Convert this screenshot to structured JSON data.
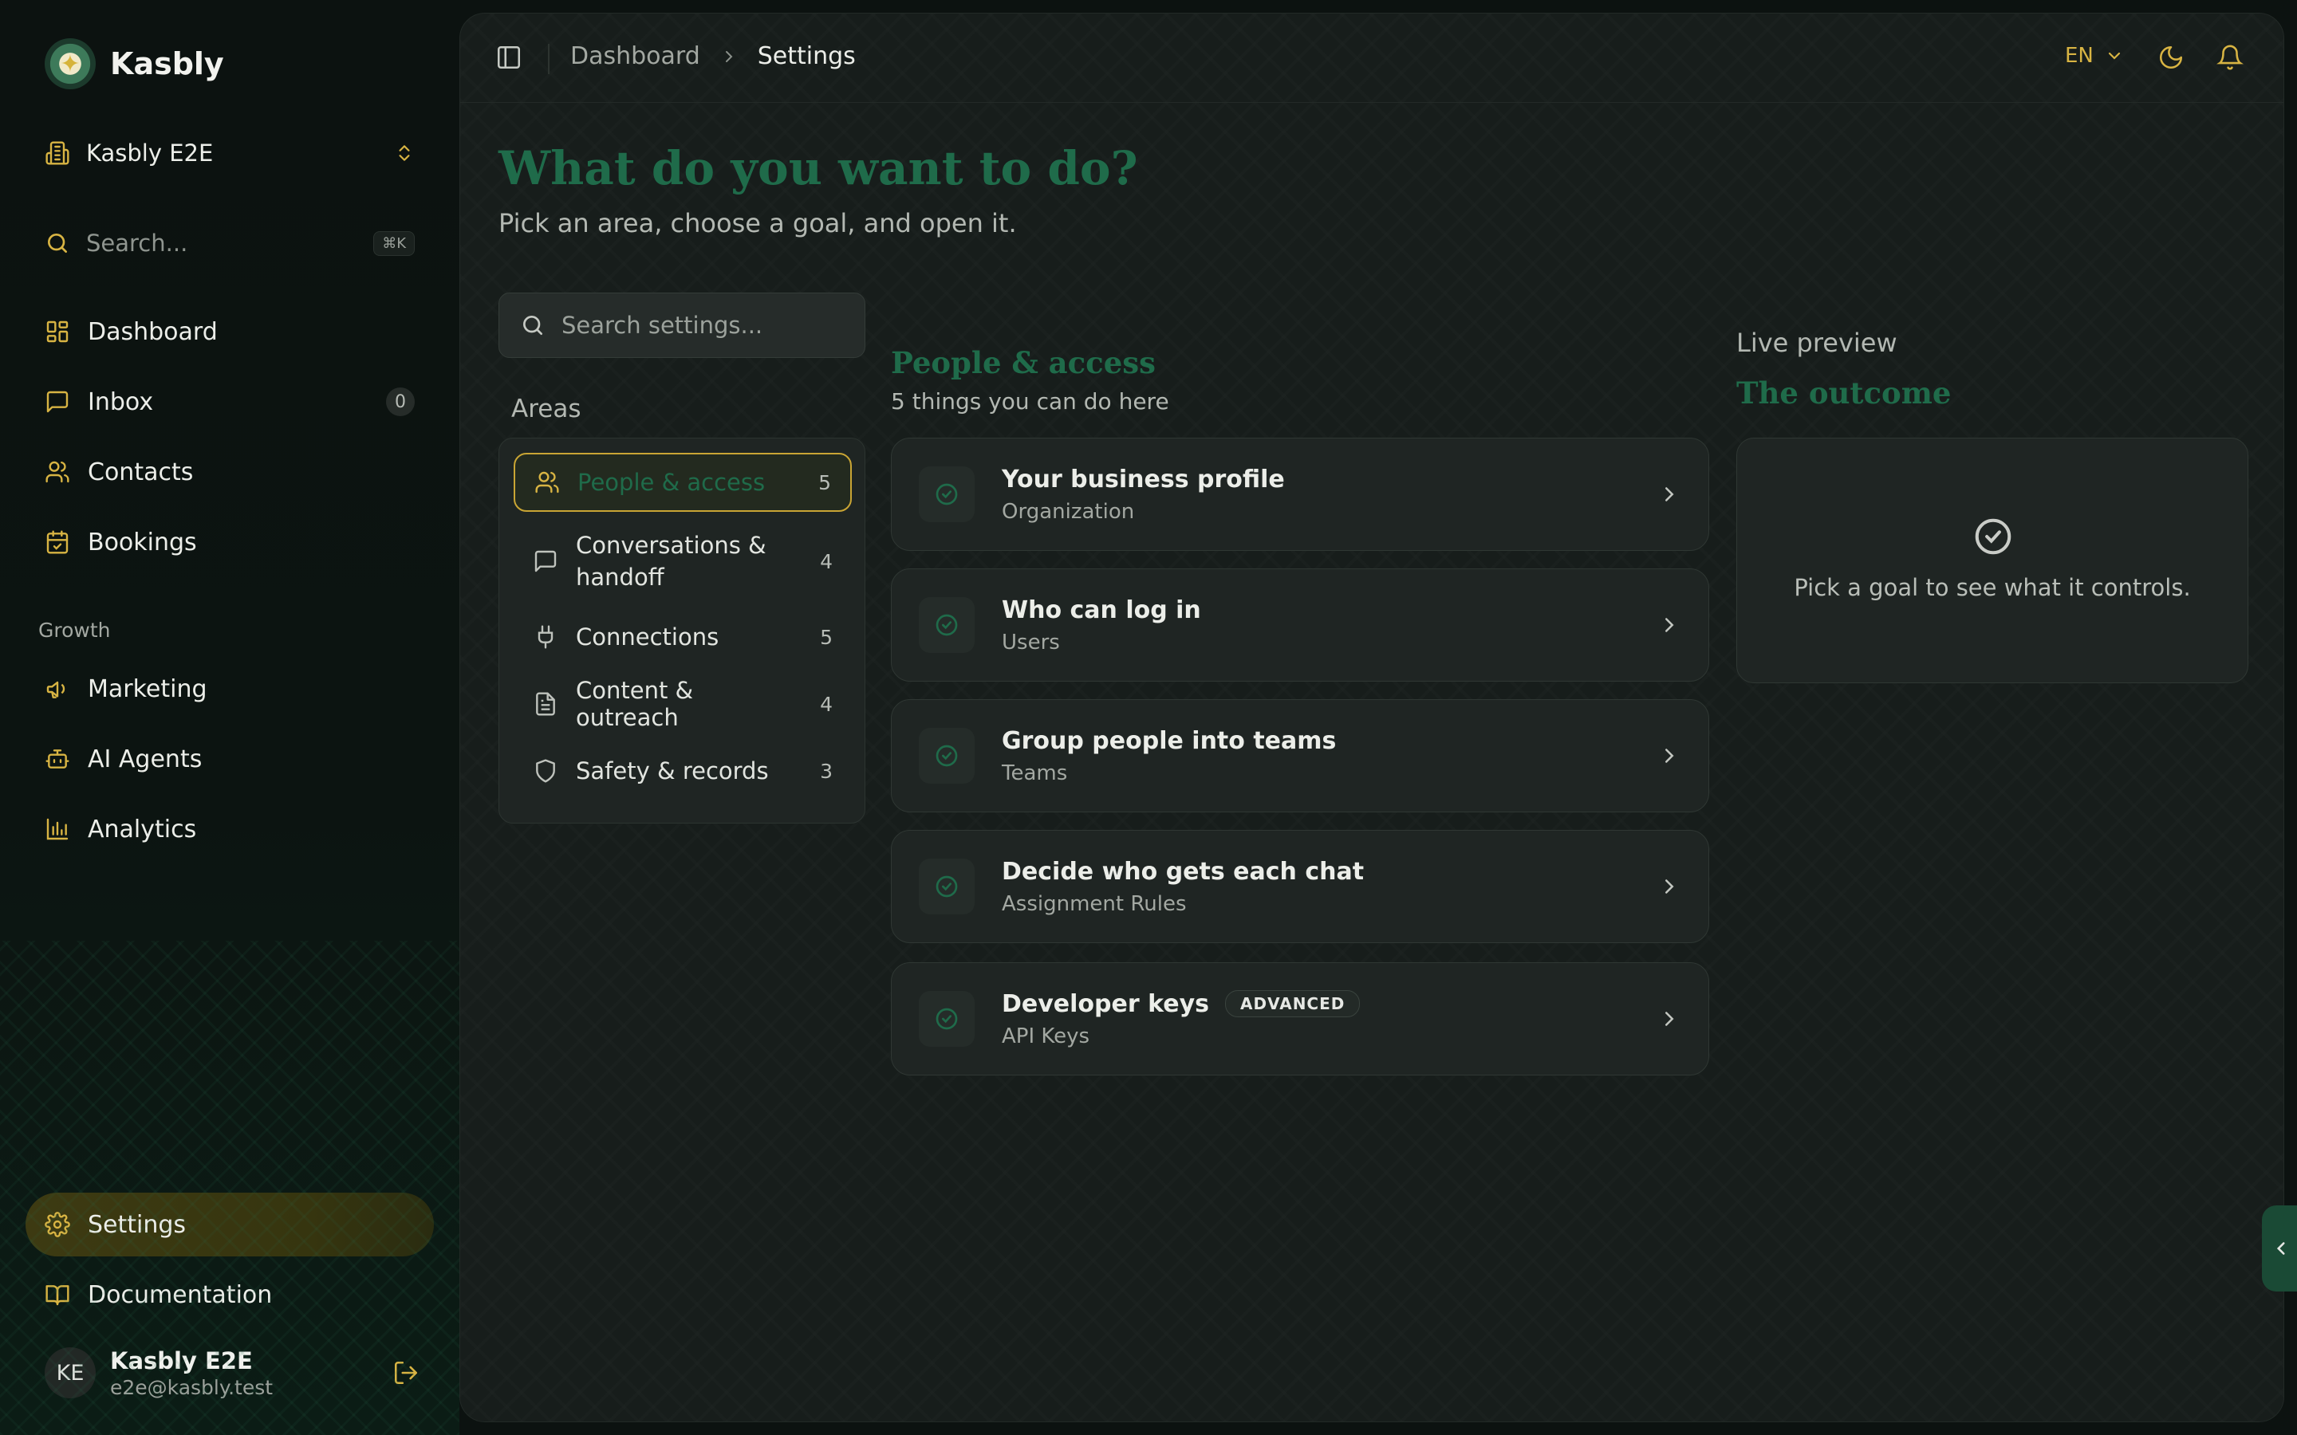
{
  "brand": {
    "name": "Kasbly"
  },
  "workspace": {
    "name": "Kasbly E2E"
  },
  "sidebar_search": {
    "placeholder": "Search...",
    "shortcut": "⌘K"
  },
  "nav": {
    "items": [
      {
        "label": "Dashboard",
        "icon": "dashboard-icon"
      },
      {
        "label": "Inbox",
        "icon": "inbox-icon",
        "count": "0"
      },
      {
        "label": "Contacts",
        "icon": "contacts-icon"
      },
      {
        "label": "Bookings",
        "icon": "calendar-icon"
      }
    ],
    "growth_label": "Growth",
    "growth_items": [
      {
        "label": "Marketing",
        "icon": "megaphone-icon"
      },
      {
        "label": "AI Agents",
        "icon": "robot-icon"
      },
      {
        "label": "Analytics",
        "icon": "bar-chart-icon"
      }
    ],
    "settings_label": "Settings",
    "documentation_label": "Documentation"
  },
  "user": {
    "initials": "KE",
    "name": "Kasbly E2E",
    "email": "e2e@kasbly.test"
  },
  "topbar": {
    "breadcrumb": [
      "Dashboard",
      "Settings"
    ],
    "language": "EN"
  },
  "page": {
    "title": "What do you want to do?",
    "subtitle": "Pick an area, choose a goal, and open it."
  },
  "settings_search": {
    "placeholder": "Search settings..."
  },
  "areas": {
    "label": "Areas",
    "items": [
      {
        "label": "People & access",
        "count": "5",
        "icon": "people-icon"
      },
      {
        "label": "Conversations & handoff",
        "count": "4",
        "icon": "chat-icon"
      },
      {
        "label": "Connections",
        "count": "5",
        "icon": "plug-icon"
      },
      {
        "label": "Content & outreach",
        "count": "4",
        "icon": "document-icon"
      },
      {
        "label": "Safety & records",
        "count": "3",
        "icon": "shield-icon"
      }
    ]
  },
  "section": {
    "title": "People & access",
    "subtitle": "5 things you can do here",
    "goals": [
      {
        "title": "Your business profile",
        "sub": "Organization"
      },
      {
        "title": "Who can log in",
        "sub": "Users"
      },
      {
        "title": "Group people into teams",
        "sub": "Teams"
      },
      {
        "title": "Decide who gets each chat",
        "sub": "Assignment Rules"
      },
      {
        "title": "Developer keys",
        "sub": "API Keys",
        "badge": "ADVANCED"
      }
    ]
  },
  "preview": {
    "label": "Live preview",
    "title": "The outcome",
    "empty_text": "Pick a goal to see what it controls."
  },
  "colors": {
    "accent_gold": "#d8b443",
    "accent_green": "#1f6b4a",
    "background": "#0c1210",
    "panel": "#171d1b"
  }
}
